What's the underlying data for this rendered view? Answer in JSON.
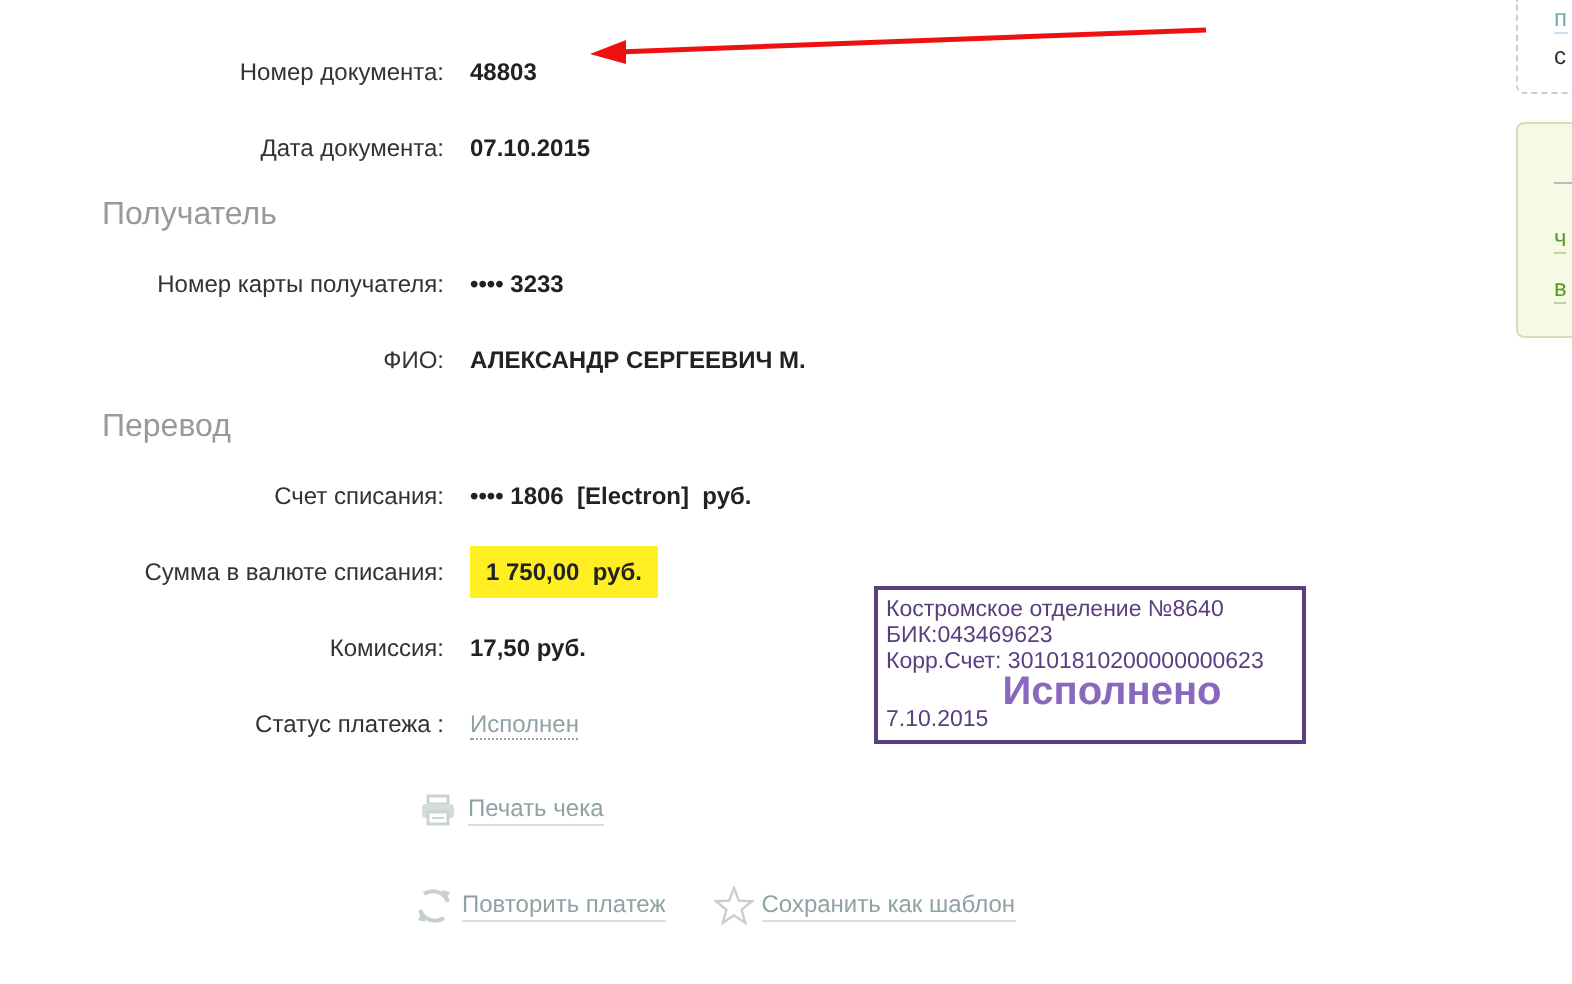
{
  "details": [
    {
      "kind": "field",
      "label": "Номер документа:",
      "value": "48803"
    },
    {
      "kind": "field",
      "label": "Дата документа:",
      "value": "07.10.2015"
    },
    {
      "kind": "section",
      "label": "Получатель"
    },
    {
      "kind": "field",
      "label": "Номер карты получателя:",
      "value": "•••• 3233"
    },
    {
      "kind": "field",
      "label": "ФИО:",
      "value": "АЛЕКСАНДР СЕРГЕЕВИЧ М."
    },
    {
      "kind": "section",
      "label": "Перевод"
    },
    {
      "kind": "field",
      "label": "Счет списания:",
      "value": "•••• 1806  [Electron]  руб."
    },
    {
      "kind": "highlight",
      "label": "Сумма в валюте списания:",
      "value": "1 750,00  руб."
    },
    {
      "kind": "field",
      "label": "Комиссия:",
      "value": "17,50 руб."
    },
    {
      "kind": "link",
      "label": "Статус платежа :",
      "value": "Исполнен"
    }
  ],
  "print_link": "Печать чека",
  "actions": [
    {
      "kind": "repeat",
      "label": "Повторить платеж"
    },
    {
      "kind": "star",
      "label": "Сохранить как шаблон"
    }
  ],
  "stamp": {
    "lines": [
      "Костромское отделение №8640",
      "БИК:043469623",
      "Корр.Счет: 30101810200000000623"
    ],
    "status": "Исполнено",
    "date": "7.10.2015"
  },
  "side_panels": [
    {
      "kind": "dashed",
      "texts": [
        {
          "kind": "link",
          "text": "п"
        },
        {
          "kind": "plain",
          "text": "с"
        }
      ]
    },
    {
      "kind": "green",
      "texts": [
        {
          "kind": "link",
          "text": "ч"
        },
        {
          "kind": "link",
          "text": "в"
        }
      ]
    }
  ]
}
